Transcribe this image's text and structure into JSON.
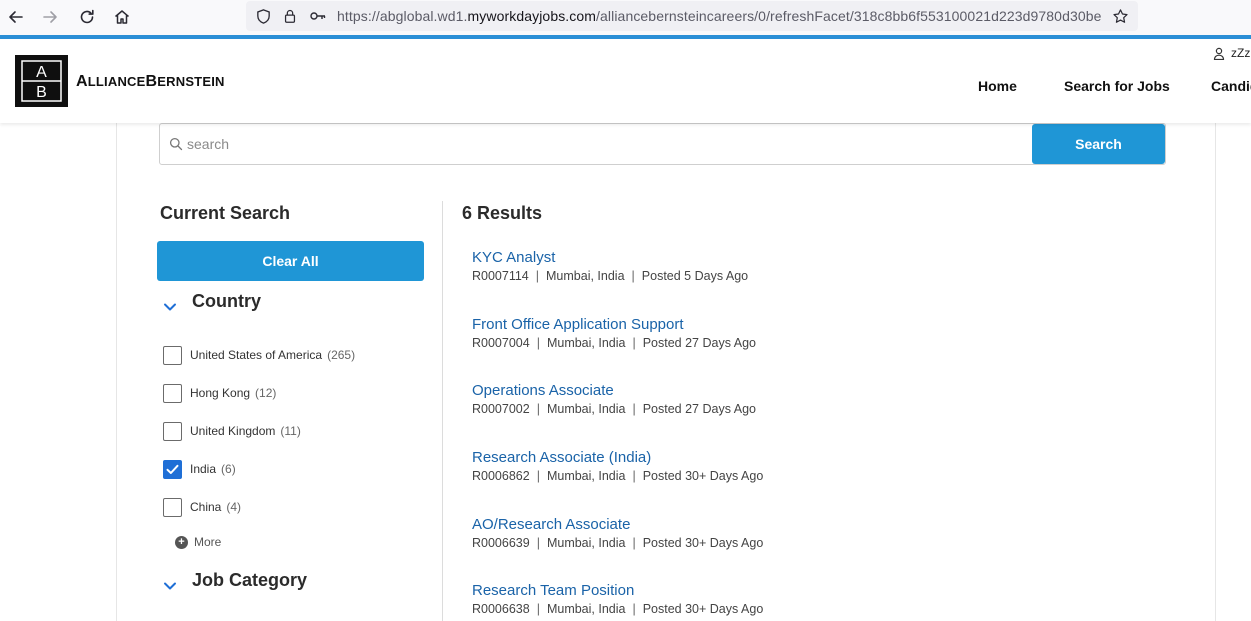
{
  "browser": {
    "url_prefix": "https://abglobal.wd1.",
    "url_domain": "myworkdayjobs.com",
    "url_suffix": "/alliancebernsteincareers/0/refreshFacet/318c8bb6f553100021d223d9780d30be"
  },
  "header": {
    "logo_mark": "A|B",
    "logo_text_a": "A",
    "logo_text_b": "LLIANCE",
    "logo_text_c": "B",
    "logo_text_d": "ERNSTEIN",
    "user_label": "zZz",
    "nav": [
      "Home",
      "Search for Jobs",
      "Candid"
    ]
  },
  "search": {
    "placeholder": "search",
    "value": "",
    "button_label": "Search"
  },
  "sidebar": {
    "current_search_heading": "Current Search",
    "clear_all_label": "Clear All",
    "country_heading": "Country",
    "countries": [
      {
        "label": "United States of America",
        "count": "(265)",
        "checked": false
      },
      {
        "label": "Hong Kong",
        "count": "(12)",
        "checked": false
      },
      {
        "label": "United Kingdom",
        "count": "(11)",
        "checked": false
      },
      {
        "label": "India",
        "count": "(6)",
        "checked": true
      },
      {
        "label": "China",
        "count": "(4)",
        "checked": false
      }
    ],
    "more_label": "More",
    "job_category_heading": "Job Category"
  },
  "results": {
    "count_label": "6 Results",
    "jobs": [
      {
        "title": "KYC Analyst",
        "id": "R0007114",
        "location": "Mumbai, India",
        "posted": "Posted 5 Days Ago"
      },
      {
        "title": "Front Office Application Support",
        "id": "R0007004",
        "location": "Mumbai, India",
        "posted": "Posted 27 Days Ago"
      },
      {
        "title": "Operations Associate",
        "id": "R0007002",
        "location": "Mumbai, India",
        "posted": "Posted 27 Days Ago"
      },
      {
        "title": "Research Associate (India)",
        "id": "R0006862",
        "location": "Mumbai, India",
        "posted": "Posted 30+ Days Ago"
      },
      {
        "title": "AO/Research Associate",
        "id": "R0006639",
        "location": "Mumbai, India",
        "posted": "Posted 30+ Days Ago"
      },
      {
        "title": "Research Team Position",
        "id": "R0006638",
        "location": "Mumbai, India",
        "posted": "Posted 30+ Days Ago"
      }
    ]
  },
  "icons": {
    "back": "arrow-left-icon",
    "forward": "arrow-right-icon",
    "reload": "reload-icon",
    "home": "home-icon",
    "shield": "shield-icon",
    "lock": "lock-icon",
    "key": "key-icon",
    "star": "star-icon",
    "user": "user-icon",
    "search": "search-icon",
    "chevron": "chevron-down-icon",
    "check": "checkmark-icon",
    "plus": "plus-circle-icon"
  },
  "colors": {
    "accent": "#1f96d6",
    "link": "#1a63a8",
    "checkbox_checked": "#1f6fd6",
    "browser_accent": "#2b8fd6"
  }
}
